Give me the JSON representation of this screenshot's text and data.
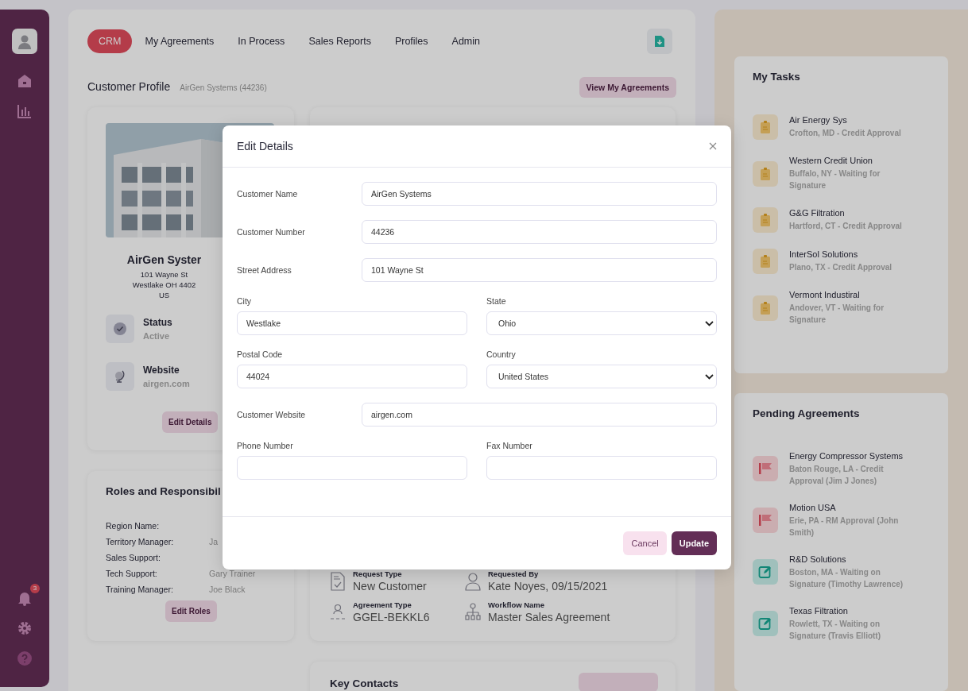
{
  "sidebar": {
    "top_items": [
      {
        "kind": "avatar"
      },
      {
        "kind": "home"
      },
      {
        "kind": "chart"
      }
    ],
    "bottom_items": [
      {
        "kind": "bell",
        "badge": "3"
      },
      {
        "kind": "gear"
      },
      {
        "kind": "help"
      }
    ]
  },
  "nav": {
    "tabs": [
      {
        "label": "CRM",
        "selected": true
      },
      {
        "label": "My Agreements",
        "selected": false
      },
      {
        "label": "In Process",
        "selected": false
      },
      {
        "label": "Sales Reports",
        "selected": false
      },
      {
        "label": "Profiles",
        "selected": false
      },
      {
        "label": "Admin",
        "selected": false
      }
    ]
  },
  "header": {
    "title": "Customer Profile",
    "subtitle": "AirGen Systems (44236)",
    "button": "View My Agreements"
  },
  "profile_card": {
    "image": {
      "kind": "picture"
    },
    "name": "AirGen Syster",
    "address": [
      "101 Wayne St",
      "Westlake OH 4402",
      "US"
    ],
    "facts": [
      {
        "kind": "status",
        "label": "Status",
        "value": "Active"
      },
      {
        "kind": "website",
        "label": "Website",
        "value": "airgen.com"
      }
    ],
    "button": "Edit Details"
  },
  "roles_card": {
    "title": "Roles and Responsibil",
    "rows": [
      {
        "label": "Region Name:"
      },
      {
        "label": "Territory Manager:",
        "value": "Ja"
      },
      {
        "label": "Sales Support:"
      },
      {
        "label": "Tech Support:",
        "value": "Gary Trainer"
      },
      {
        "label": "Training Manager:",
        "value": "Joe Black"
      }
    ],
    "button": "Edit Roles"
  },
  "request_card": {
    "items": [
      {
        "kind": "document",
        "label": "Request Type",
        "value": "New Customer"
      },
      {
        "kind": "person",
        "label": "Requested By",
        "value": "Kate Noyes, 09/15/2021"
      },
      {
        "kind": "award",
        "label": "Agreement Type",
        "value": "GGEL-BEKKL6"
      },
      {
        "kind": "hierarchy",
        "label": "Workflow Name",
        "value": "Master Sales Agreement"
      }
    ]
  },
  "contacts_card": {
    "title": "Key Contacts"
  },
  "my_tasks": {
    "title": "My Tasks",
    "items": [
      {
        "name": "Air Energy Sys",
        "detail": "Crofton, MD - Credit Approval"
      },
      {
        "name": "Western Credit Union",
        "detail": "Buffalo, NY - Waiting for Signature"
      },
      {
        "name": "G&G Filtration",
        "detail": "Hartford, CT - Credit Approval"
      },
      {
        "name": "InterSol Solutions",
        "detail": "Plano, TX - Credit Approval"
      },
      {
        "name": "Vermont Industiral",
        "detail": "Andover, VT - Waiting for Signature"
      }
    ]
  },
  "pending_agreements": {
    "title": "Pending Agreements",
    "items": [
      {
        "kind": "flag",
        "name": "Energy Compressor Systems",
        "detail": "Baton Rouge, LA - Credit Approval (Jim J Jones)"
      },
      {
        "kind": "flag",
        "name": "Motion USA",
        "detail": "Erie, PA - RM Approval (John Smith)"
      },
      {
        "kind": "edit",
        "name": "R&D Solutions",
        "detail": "Boston, MA - Waiting on Signature (Timothy Lawrence)"
      },
      {
        "kind": "edit",
        "name": "Texas Filtration",
        "detail": "Rowlett, TX - Waiting on Signature (Travis Elliott)"
      }
    ]
  },
  "modal": {
    "title": "Edit Details",
    "rows": [
      {
        "kind": "inline",
        "fields": [
          {
            "label": "Customer Name",
            "kind": "text",
            "value": "AirGen Systems"
          }
        ]
      },
      {
        "kind": "inline",
        "fields": [
          {
            "label": "Customer Number",
            "kind": "text",
            "value": "44236"
          }
        ]
      },
      {
        "kind": "inline",
        "fields": [
          {
            "label": "Street Address",
            "kind": "text",
            "value": "101 Wayne St"
          }
        ]
      },
      {
        "kind": "pair",
        "fields": [
          {
            "label": "City",
            "kind": "text",
            "value": "Westlake"
          },
          {
            "label": "State",
            "kind": "select",
            "value": "Ohio"
          }
        ]
      },
      {
        "kind": "pair",
        "fields": [
          {
            "label": "Postal Code",
            "kind": "text",
            "value": "44024"
          },
          {
            "label": "Country",
            "kind": "select",
            "value": "United States"
          }
        ]
      },
      {
        "kind": "inline",
        "fields": [
          {
            "label": "Customer Website",
            "kind": "text",
            "value": "airgen.com"
          }
        ]
      },
      {
        "kind": "pair",
        "fields": [
          {
            "label": "Phone Number",
            "kind": "text"
          },
          {
            "label": "Fax Number",
            "kind": "text"
          }
        ]
      }
    ],
    "buttons": [
      {
        "kind": "secondary",
        "label": "Cancel"
      },
      {
        "kind": "primary",
        "label": "Update"
      }
    ]
  }
}
